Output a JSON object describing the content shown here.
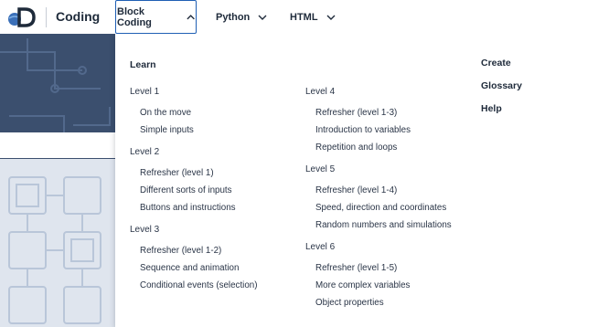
{
  "header": {
    "brand": "Coding",
    "nav": [
      {
        "label": "Block Coding",
        "active": true
      },
      {
        "label": "Python",
        "active": false
      },
      {
        "label": "HTML",
        "active": false
      }
    ]
  },
  "dropdown": {
    "heading": "Learn",
    "levels": [
      {
        "title": "Level 1",
        "links": [
          "On the move",
          "Simple inputs"
        ]
      },
      {
        "title": "Level 2",
        "links": [
          "Refresher (level 1)",
          "Different sorts of inputs",
          "Buttons and instructions"
        ]
      },
      {
        "title": "Level 3",
        "links": [
          "Refresher (level 1-2)",
          "Sequence and animation",
          "Conditional events (selection)"
        ]
      },
      {
        "title": "Level 4",
        "links": [
          "Refresher (level 1-3)",
          "Introduction to variables",
          "Repetition and loops"
        ]
      },
      {
        "title": "Level 5",
        "links": [
          "Refresher (level 1-4)",
          "Speed, direction and coordinates",
          "Random numbers and simulations"
        ]
      },
      {
        "title": "Level 6",
        "links": [
          "Refresher (level 1-5)",
          "More complex variables",
          "Object properties"
        ]
      }
    ],
    "side_links": [
      "Create",
      "Glossary",
      "Help"
    ]
  },
  "colors": {
    "accent": "#1f5fb4",
    "banner_bg": "#3b4f6e",
    "lower_bg": "#dfe5ee",
    "text": "#1e2a3a"
  },
  "icons": {
    "logo": "discovery-globe-logo",
    "chevron_up": "chevron-up-icon",
    "chevron_down": "chevron-down-icon"
  }
}
